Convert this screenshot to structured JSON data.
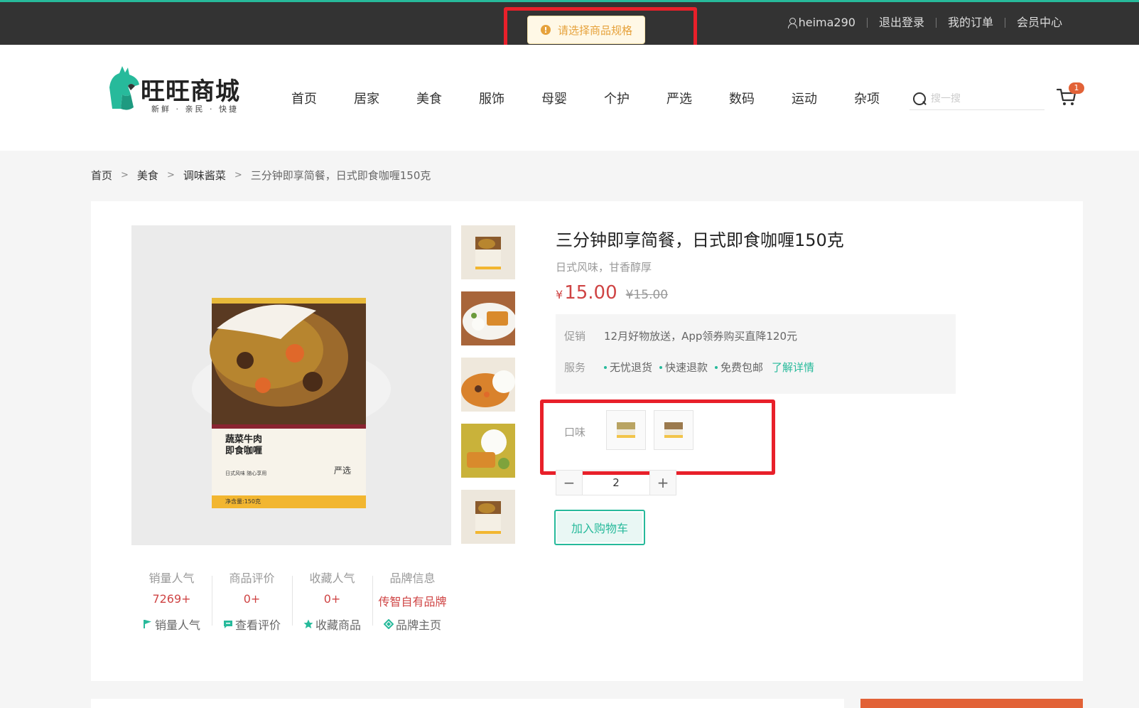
{
  "topbar": {
    "username": "heima290",
    "logout": "退出登录",
    "orders": "我的订单",
    "member": "会员中心"
  },
  "toast": {
    "message": "请选择商品规格",
    "icon": "warning-icon",
    "color": "#e6a23c"
  },
  "header": {
    "logo_text": "旺旺商城",
    "logo_sub": "新鲜 · 亲民 · 快捷",
    "nav": [
      "首页",
      "居家",
      "美食",
      "服饰",
      "母婴",
      "个护",
      "严选",
      "数码",
      "运动",
      "杂项"
    ],
    "search_placeholder": "搜一搜",
    "cart_count": "1"
  },
  "breadcrumb": [
    "首页",
    "美食",
    "调味酱菜",
    "三分钟即享简餐，日式即食咖喱150克"
  ],
  "product": {
    "title": "三分钟即享简餐，日式即食咖喱150克",
    "subtitle": "日式风味，甘香醇厚",
    "price_symbol": "¥",
    "price": "15.00",
    "old_price": "¥15.00",
    "promo_label": "促销",
    "promo_text": "12月好物放送，App领券购买直降120元",
    "service_label": "服务",
    "services": [
      "无忧退货",
      "快速退款",
      "免费包邮"
    ],
    "service_link": "了解详情",
    "spec_label": "口味",
    "quantity": "2",
    "add_to_cart": "加入购物车",
    "box_name_line1": "蔬菜牛肉",
    "box_name_line2": "即食咖喱",
    "box_tagline": "日式风味 随心享用",
    "box_brand": "严选",
    "box_weight": "净含量:150克"
  },
  "stats": [
    {
      "label": "销量人气",
      "value": "7269+",
      "link": "销量人气",
      "icon": "flag-icon"
    },
    {
      "label": "商品评价",
      "value": "0+",
      "link": "查看评价",
      "icon": "comment-icon"
    },
    {
      "label": "收藏人气",
      "value": "0+",
      "link": "收藏商品",
      "icon": "star-icon"
    },
    {
      "label": "品牌信息",
      "value": "传智自有品牌",
      "link": "品牌主页",
      "icon": "brand-icon"
    }
  ],
  "colors": {
    "accent": "#27ba9b",
    "price": "#cf4444",
    "topbar": "#333333",
    "highlight_box": "#e8202a",
    "cart_badge": "#e26237"
  }
}
